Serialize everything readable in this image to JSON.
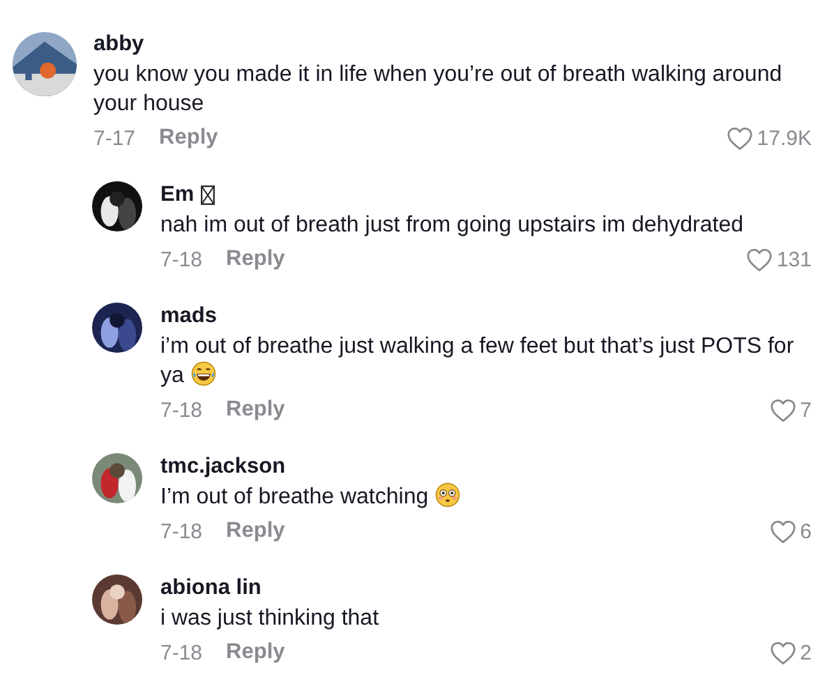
{
  "comments": [
    {
      "username": "abby",
      "text": "you know you made it in life when you’re out of breath walking around your house",
      "date": "7-17",
      "reply_label": "Reply",
      "likes": "17.9K",
      "replies": [
        {
          "username": "Em",
          "name_icon": {
            "kind": "missing_glyph"
          },
          "text": "nah im out of breath just from going upstairs im dehydrated",
          "date": "7-18",
          "reply_label": "Reply",
          "likes": "131"
        },
        {
          "username": "mads",
          "text": "i’m out of breathe just walking a few feet but that’s just POTS for ya",
          "text_icon": {
            "kind": "laughing"
          },
          "date": "7-18",
          "reply_label": "Reply",
          "likes": "7"
        },
        {
          "username": "tmc.jackson",
          "text": "I’m out of breathe watching",
          "text_icon": {
            "kind": "flushed"
          },
          "date": "7-18",
          "reply_label": "Reply",
          "likes": "6"
        },
        {
          "username": "abiona lin",
          "text": "i was just thinking that",
          "date": "7-18",
          "reply_label": "Reply",
          "likes": "2"
        }
      ]
    }
  ]
}
